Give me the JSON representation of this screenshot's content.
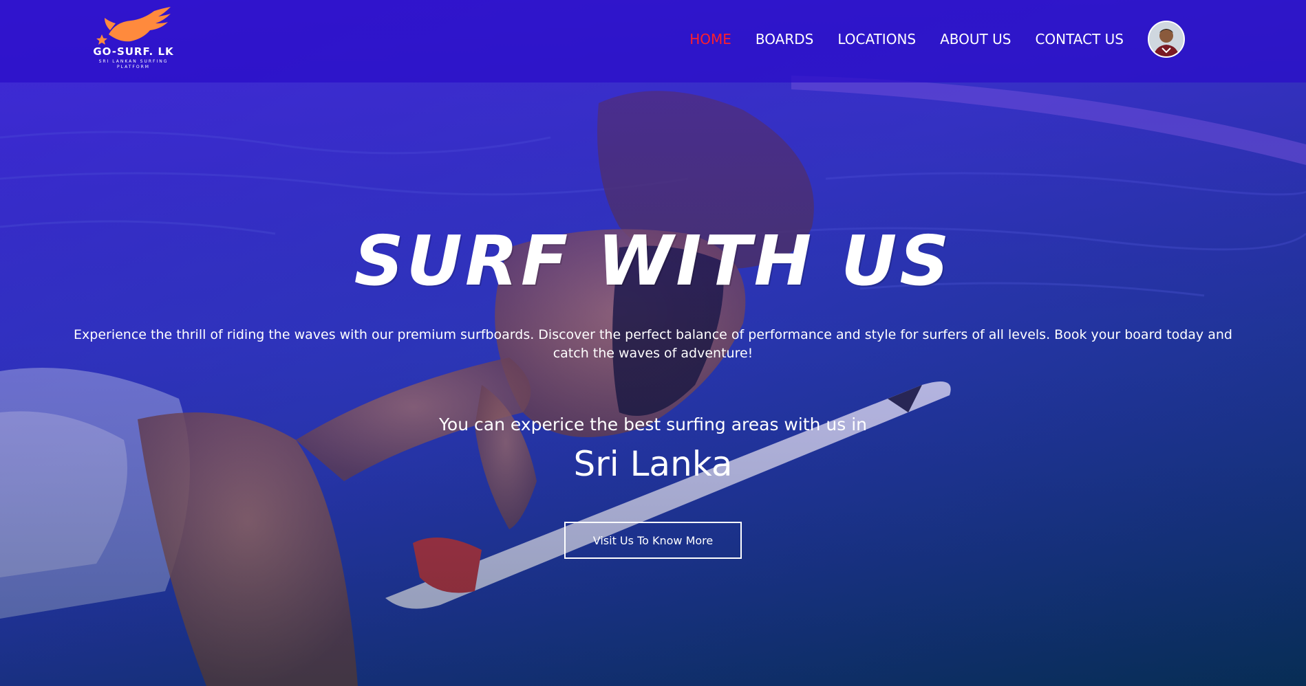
{
  "theme": {
    "header_overlay": "#2a0cc8",
    "nav_active": "#ff1f2b",
    "logo_orange": "#ff8a3d",
    "text": "#ffffff"
  },
  "brand": {
    "logo_icon": "eagle-logo-icon",
    "name": "GO-SURF. LK",
    "tagline": "SRI LANKAN SURFING PLATFORM"
  },
  "nav": {
    "items": [
      {
        "label": "HOME",
        "active": true
      },
      {
        "label": "BOARDS",
        "active": false
      },
      {
        "label": "LOCATIONS",
        "active": false
      },
      {
        "label": "ABOUT US",
        "active": false
      },
      {
        "label": "CONTACT US",
        "active": false
      }
    ],
    "avatar_icon": "user-avatar"
  },
  "hero": {
    "title": "SURF WITH US",
    "description": "Experience the thrill of riding the waves with our premium surfboards. Discover the perfect balance of performance and style for surfers of all levels. Book your board today and catch the waves of adventure!",
    "subheading": "You can experice the best surfing areas with us in",
    "location": "Sri Lanka",
    "cta_label": "Visit Us To Know More",
    "background_image": "surfer-on-wave-photo"
  }
}
